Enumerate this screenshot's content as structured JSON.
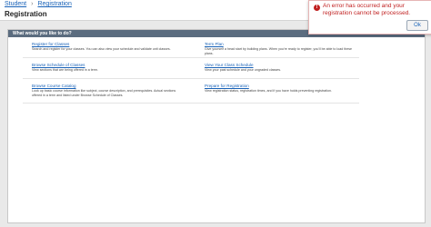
{
  "breadcrumb": {
    "home": "Student",
    "current": "Registration"
  },
  "header": {
    "title": "Registration"
  },
  "panel": {
    "heading": "What would you like to do?"
  },
  "links": [
    {
      "title": "Register for Classes",
      "desc": "Search and register for your classes. You can also view your schedule and validate unit classes."
    },
    {
      "title": "Term Plan",
      "desc": "Give yourself a head start by building plans. When you're ready to register, you'll be able to load these plans."
    },
    {
      "title": "Browse Schedule of Classes",
      "desc": "View sections that are being offered in a term."
    },
    {
      "title": "View Your Class Schedule",
      "desc": "View your past schedule and your ungraded classes."
    },
    {
      "title": "Browse Course Catalog",
      "desc": "Look up basic course information like subject, course description, and prerequisites. Actual sections offered in a term and listed under Browse Schedule of Classes."
    },
    {
      "title": "Prepare for Registration",
      "desc": "View registration status, registration times, and if you have holds preventing registration."
    }
  ],
  "error": {
    "message": "An error has occurred and your registration cannot be processed.",
    "ok_label": "Ok",
    "accent_color": "#c01f1f"
  }
}
